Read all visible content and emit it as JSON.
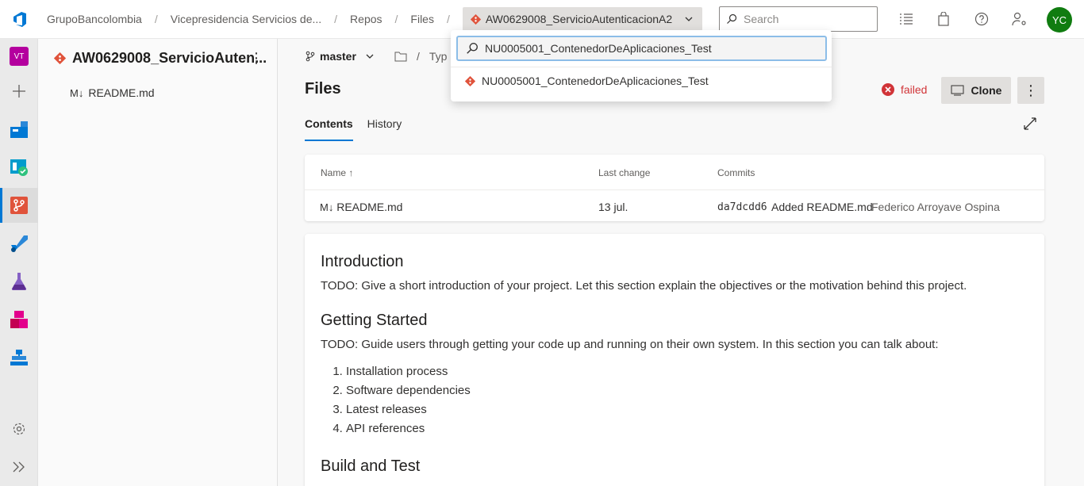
{
  "breadcrumbs": {
    "org": "GrupoBancolombia",
    "project": "Vicepresidencia Servicios de...",
    "repos": "Repos",
    "files": "Files",
    "repo": "AW0629008_ServicioAutenticacionA2"
  },
  "search": {
    "placeholder": "Search"
  },
  "user": {
    "initials": "YC",
    "avatar_color": "#107c10"
  },
  "project_badge": "VT",
  "repo_panel": {
    "title": "AW0629008_ServicioAuten...",
    "items": [
      {
        "label": "README.md"
      }
    ]
  },
  "main": {
    "branch": "master",
    "path_placeholder": "Typ",
    "title": "Files",
    "status": "failed",
    "clone_label": "Clone",
    "tabs": [
      {
        "label": "Contents"
      },
      {
        "label": "History"
      }
    ]
  },
  "files_table": {
    "headers": {
      "name": "Name",
      "last_change": "Last change",
      "commits": "Commits"
    },
    "rows": [
      {
        "name": "README.md",
        "last_change": "13 jul.",
        "commit_hash": "da7dcdd6",
        "commit_message": "Added README.md",
        "author": "Federico Arroyave Ospina"
      }
    ]
  },
  "readme": {
    "intro_heading": "Introduction",
    "intro_text": "TODO: Give a short introduction of your project. Let this section explain the objectives or the motivation behind this project.",
    "getting_started_heading": "Getting Started",
    "getting_started_text": "TODO: Guide users through getting your code up and running on their own system. In this section you can talk about:",
    "steps": [
      "Installation process",
      "Software dependencies",
      "Latest releases",
      "API references"
    ],
    "build_heading": "Build and Test"
  },
  "dropdown": {
    "search_value": "NU0005001_ContenedorDeAplicaciones_Test",
    "items": [
      {
        "label": "NU0005001_ContenedorDeAplicaciones_Test"
      }
    ]
  },
  "colors": {
    "accent": "#0078d4",
    "git": "#e0533b",
    "failed": "#d13438"
  }
}
